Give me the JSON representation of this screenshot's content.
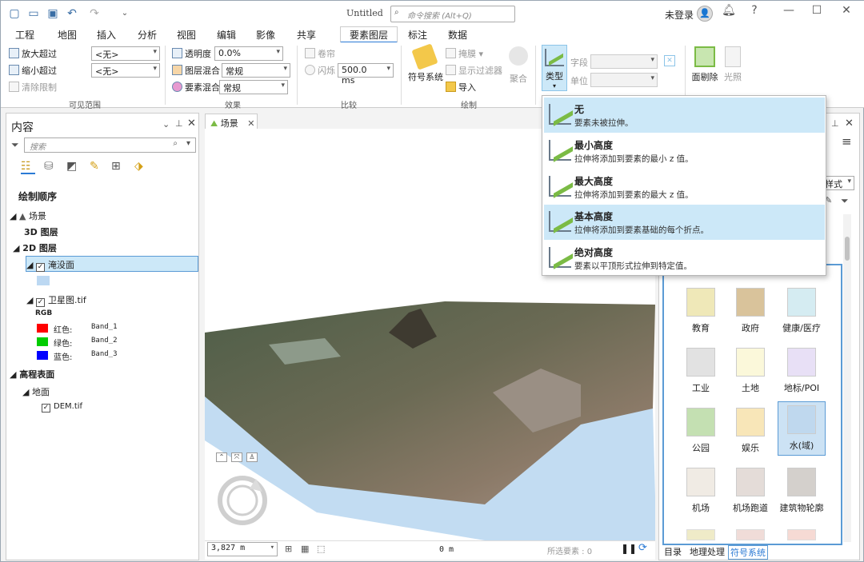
{
  "titlebar": {
    "title": "Untitled",
    "search_placeholder": "命令搜索 (Alt+Q)",
    "user": "未登录",
    "help": "?"
  },
  "ribbon_tabs": [
    "工程",
    "地图",
    "插入",
    "分析",
    "视图",
    "编辑",
    "影像",
    "共享",
    "要素图层",
    "标注",
    "数据"
  ],
  "ribbon": {
    "zoom_in": "放大超过",
    "zoom_out": "缩小超过",
    "clear_limits": "清除限制",
    "zoom_in_value": "<无>",
    "zoom_out_value": "<无>",
    "group_visible": "可见范围",
    "transparency": "透明度",
    "transparency_value": "0.0%",
    "layer_blend": "图层混合",
    "layer_blend_value": "常规",
    "feature_blend": "要素混合",
    "feature_blend_value": "常规",
    "group_effects": "效果",
    "swipe": "卷帘",
    "flicker": "闪烁",
    "flicker_value": "500.0  ms",
    "group_compare": "比较",
    "symbology": "符号系统",
    "mask": "掩膜",
    "show_filter": "显示过滤器",
    "import": "导入",
    "aggregate": "聚合",
    "group_drawing": "绘制",
    "type": "类型",
    "field": "字段",
    "unit": "单位",
    "face_culling": "面剔除",
    "lighting": "光照"
  },
  "contents": {
    "title": "内容",
    "search_placeholder": "搜索",
    "draw_order": "绘制顺序",
    "scene": "场景",
    "layer_3d": "3D 图层",
    "layer_2d": "2D 图层",
    "flood": "淹没面",
    "satellite": "卫星图.tif",
    "rgb": "RGB",
    "bands": [
      {
        "label": "红色:",
        "band": "Band_1",
        "color": "#ff0000"
      },
      {
        "label": "绿色:",
        "band": "Band_2",
        "color": "#00cc00"
      },
      {
        "label": "蓝色:",
        "band": "Band_3",
        "color": "#0000ff"
      }
    ],
    "elevation": "高程表面",
    "ground": "地面",
    "dem": "DEM.tif"
  },
  "map": {
    "tab": "场景",
    "scale": "3,827 m",
    "elevation": "0 m",
    "selected": "所选要素 : 0"
  },
  "extrusion_menu": [
    {
      "title": "无",
      "desc": "要素未被拉伸。"
    },
    {
      "title": "最小高度",
      "desc": "拉伸将添加到要素的最小 z 值。"
    },
    {
      "title": "最大高度",
      "desc": "拉伸将添加到要素的最大 z 值。"
    },
    {
      "title": "基本高度",
      "desc": "拉伸将添加到要素基础的每个折点。"
    },
    {
      "title": "绝对高度",
      "desc": "要素以平顶形式拉伸到特定值。"
    }
  ],
  "symbols": [
    {
      "label": "教育",
      "color": "#efe8b8"
    },
    {
      "label": "政府",
      "color": "#d9c39b"
    },
    {
      "label": "健康/医疗",
      "color": "#d5ecf2"
    },
    {
      "label": "工业",
      "color": "#e2e2e2"
    },
    {
      "label": "土地",
      "color": "#fbf8da"
    },
    {
      "label": "地标/POI",
      "color": "#e8e0f6"
    },
    {
      "label": "公园",
      "color": "#c4e0b2"
    },
    {
      "label": "娱乐",
      "color": "#f8e6b8"
    },
    {
      "label": "水(域)",
      "color": "#bfd8ee"
    },
    {
      "label": "机场",
      "color": "#f0ebe4"
    },
    {
      "label": "机场跑道",
      "color": "#e4dcd8"
    },
    {
      "label": "建筑物轮廓",
      "color": "#d4d0cc"
    }
  ],
  "style_dropdown": "样式",
  "bottom_tabs": [
    "目录",
    "地理处理",
    "符号系统"
  ]
}
